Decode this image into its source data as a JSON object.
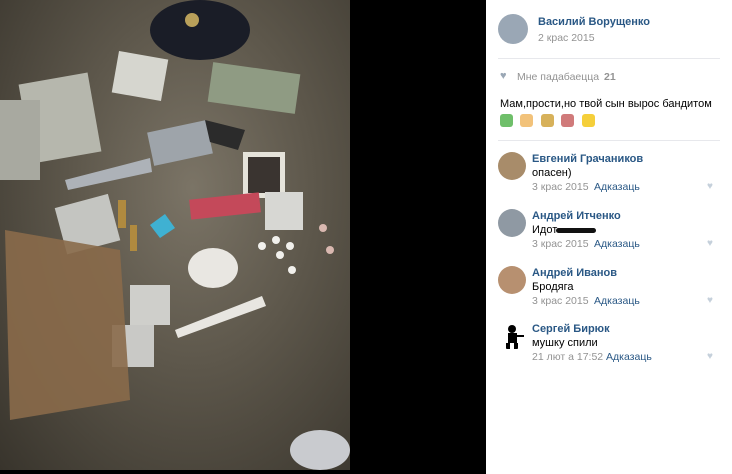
{
  "post": {
    "author": "Василий Ворущенко",
    "date": "2 крас 2015",
    "likes_label": "Мне падабаецца",
    "likes_count": "21",
    "caption": "Мам,прости,но твой сын вырос бандитом",
    "emoji": [
      "gun-emoji",
      "fist-emoji",
      "money-bag-emoji",
      "syringe-emoji",
      "sunglasses-emoji"
    ]
  },
  "comments": [
    {
      "name": "Евгений Грачаников",
      "text": "опасен)",
      "date": "3 крас 2015",
      "reply": "Адказаць"
    },
    {
      "name": "Андрей Итченко",
      "text": "Идот",
      "date": "3 крас 2015",
      "reply": "Адказаць"
    },
    {
      "name": "Андрей Иванов",
      "text": "Бродяга",
      "date": "3 крас 2015",
      "reply": "Адказаць"
    },
    {
      "name": "Сергей Бирюк",
      "text": "мушку спили",
      "date": "21 лют а 17:52",
      "reply": "Адказаць"
    }
  ]
}
